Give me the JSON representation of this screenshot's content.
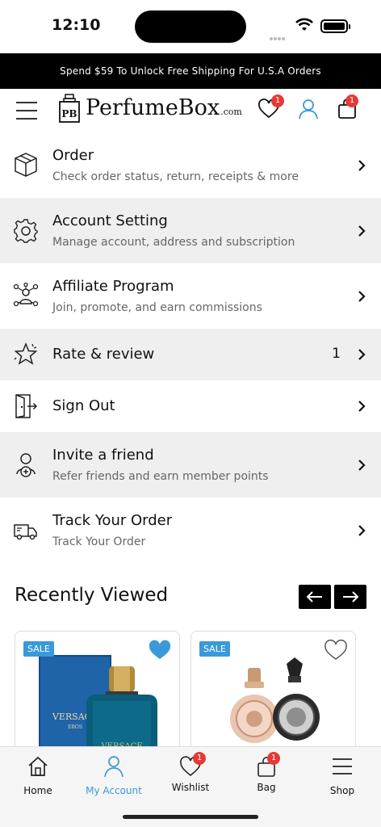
{
  "status_bar": {
    "time": "12:10"
  },
  "promo": {
    "text": "Spend $59 To Unlock Free Shipping For U.S.A Orders"
  },
  "header": {
    "logo_mark": "PB",
    "logo_text": "PerfumeBox",
    "logo_suffix": ".com",
    "wishlist_count": "1",
    "bag_count": "1"
  },
  "menu": {
    "items": [
      {
        "title": "Order",
        "subtitle": "Check order status, return, receipts & more",
        "icon": "box-icon"
      },
      {
        "title": "Account Setting",
        "subtitle": "Manage account, address and subscription",
        "icon": "gear-icon"
      },
      {
        "title": "Affiliate Program",
        "subtitle": "Join, promote, and earn commissions",
        "icon": "network-icon"
      },
      {
        "title": "Rate & review",
        "count": "1",
        "icon": "star-icon"
      },
      {
        "title": "Sign Out",
        "icon": "exit-door-icon"
      },
      {
        "title": "Invite a friend",
        "subtitle": "Refer friends and earn member points",
        "icon": "add-user-icon"
      },
      {
        "title": "Track Your Order",
        "subtitle": "Track Your Order",
        "icon": "truck-icon"
      }
    ]
  },
  "recently_viewed": {
    "title": "Recently Viewed",
    "products": [
      {
        "badge": "SALE",
        "wishlisted": true,
        "brand_text": "VERSACE",
        "product_text": "EROS"
      },
      {
        "badge": "SALE",
        "wishlisted": false
      }
    ]
  },
  "bottom_nav": {
    "items": [
      {
        "label": "Home",
        "icon": "home-icon"
      },
      {
        "label": "My Account",
        "icon": "user-icon",
        "active": true
      },
      {
        "label": "Wishlist",
        "icon": "heart-icon",
        "badge": "1"
      },
      {
        "label": "Bag",
        "icon": "bag-icon",
        "badge": "1"
      },
      {
        "label": "Shop",
        "icon": "menu-icon"
      }
    ]
  },
  "colors": {
    "accent": "#3a9ad9",
    "badge": "#e53935",
    "banner": "#000000",
    "row_shade": "#efefef"
  }
}
